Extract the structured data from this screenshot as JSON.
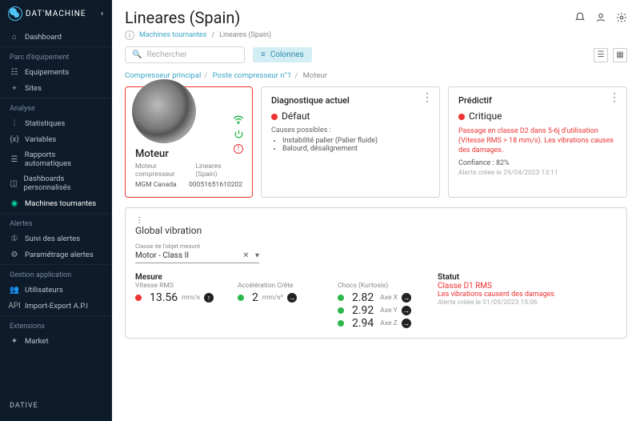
{
  "brand": "DAT'MACHINE",
  "footer_brand": "DATIVE",
  "sidebar": {
    "items": [
      {
        "label": "Dashboard"
      }
    ],
    "sections": [
      {
        "title": "Parc d'équipement",
        "items": [
          {
            "label": "Equipements"
          },
          {
            "label": "Sites"
          }
        ]
      },
      {
        "title": "Analyse",
        "items": [
          {
            "label": "Statistiques"
          },
          {
            "label": "Variables"
          },
          {
            "label": "Rapports automatiques"
          },
          {
            "label": "Dashboards personnalisés"
          },
          {
            "label": "Machines tournantes",
            "active": true
          }
        ]
      },
      {
        "title": "Alertes",
        "items": [
          {
            "label": "Suivi des alertes"
          },
          {
            "label": "Paramétrage alertes"
          }
        ]
      },
      {
        "title": "Gestion application",
        "items": [
          {
            "label": "Utilisateurs"
          },
          {
            "label": "Import-Export A.P.I"
          }
        ]
      },
      {
        "title": "Extensions",
        "items": [
          {
            "label": "Market"
          }
        ]
      }
    ]
  },
  "page": {
    "title": "Lineares (Spain)",
    "crumb_parent": "Machines tournantes",
    "crumb_current": "Lineares (Spain)",
    "search_placeholder": "Rechercher",
    "columns_label": "Colonnes",
    "sub_crumbs": [
      "Compresseur principal",
      "Poste compresseur n°1",
      "Moteur"
    ]
  },
  "machine": {
    "name": "Moteur",
    "type": "Moteur compresseur",
    "site": "Lineares (Spain)",
    "manufacturer": "MGM Canada",
    "serial": "00051651610202"
  },
  "diagnostic": {
    "title": "Diagnostique actuel",
    "state": "Défaut",
    "causes_title": "Causes possibles :",
    "causes": [
      "Instabilité palier (Palier fluide)",
      "Balourd, désalignement"
    ]
  },
  "predictive": {
    "title": "Prédictif",
    "state": "Critique",
    "message": "Passage en classe D2 dans 5-6j d'utilisation (Vitesse RMS > 18 mm/s). Les vibrations causes des damages.",
    "confidence_label": "Confiance : 82%",
    "created": "Alerte créée le 29/04/2023 13:11"
  },
  "global": {
    "title": "Global vibration",
    "class_label": "Classe de l'objet mesuré",
    "class_value": "Motor - Class II",
    "measure_title": "Mesure",
    "cols": [
      {
        "label": "Vitesse RMS",
        "value": "13.56",
        "unit": "mm/s",
        "dot": "red"
      },
      {
        "label": "Accélération Crête",
        "value": "2",
        "unit": "mm/s²",
        "dot": "green"
      }
    ],
    "shocks": {
      "label": "Chocs (Kurtosis)",
      "axes": [
        {
          "value": "2.82",
          "axis": "Axe X"
        },
        {
          "value": "2.92",
          "axis": "Axe Y"
        },
        {
          "value": "2.94",
          "axis": "Axe Z"
        }
      ]
    },
    "status": {
      "title": "Statut",
      "class": "Classe D1 RMS",
      "msg": "Les vibrations causent des damages",
      "created": "Alerte créée le 01/05/2023 15:06"
    }
  }
}
